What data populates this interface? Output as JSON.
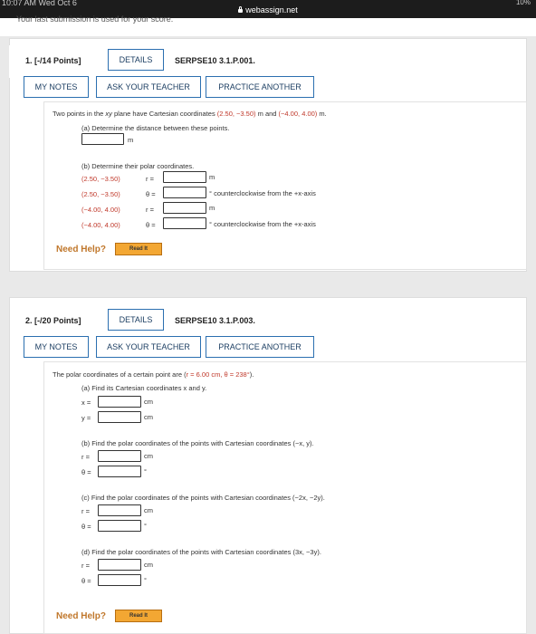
{
  "status_bar": {
    "left_text": "10:07 AM Wed Oct 6",
    "url": "webassign.net",
    "right_text": "10%"
  },
  "page": {
    "submission_text": "Your last submission is used for your score."
  },
  "q1": {
    "number": "1. [-/14 Points]",
    "details": "DETAILS",
    "code": "SERPSE10 3.1.P.001.",
    "my_notes": "MY NOTES",
    "ask_teacher": "ASK YOUR TEACHER",
    "practice": "PRACTICE ANOTHER",
    "intro_a": "Two points in the ",
    "intro_b": "xy",
    "intro_c": " plane have Cartesian coordinates ",
    "intro_d": "(2.50, −3.50)",
    "intro_e": " m and ",
    "intro_f": "(−4.00, 4.00)",
    "intro_g": " m.",
    "part_a": "(a) Determine the distance between these points.",
    "unit_m": "m",
    "part_b": "(b) Determine their polar coordinates.",
    "rows": [
      {
        "coord": "(2.50, −3.50)",
        "var": "r =",
        "unit": "m"
      },
      {
        "coord": "(2.50, −3.50)",
        "var": "θ =",
        "unit": "° counterclockwise from the +x-axis"
      },
      {
        "coord": "(−4.00, 4.00)",
        "var": "r =",
        "unit": "m"
      },
      {
        "coord": "(−4.00, 4.00)",
        "var": "θ =",
        "unit": "° counterclockwise from the +x-axis"
      }
    ],
    "need_help": "Need Help?",
    "read_it": "Read It"
  },
  "q2": {
    "number": "2. [-/20 Points]",
    "details": "DETAILS",
    "code": "SERPSE10 3.1.P.003.",
    "my_notes": "MY NOTES",
    "ask_teacher": "ASK YOUR TEACHER",
    "practice": "PRACTICE ANOTHER",
    "intro_a": "The polar coordinates of a certain point are (",
    "intro_b": "r = 6.00 cm, θ = 238°",
    "intro_c": ").",
    "part_a": "(a) Find its Cartesian coordinates x and y.",
    "a_rows": [
      {
        "var": "x =",
        "unit": "cm"
      },
      {
        "var": "y =",
        "unit": "cm"
      }
    ],
    "part_b": "(b) Find the polar coordinates of the points with Cartesian coordinates (−x, y).",
    "b_rows": [
      {
        "var": "r =",
        "unit": "cm"
      },
      {
        "var": "θ =",
        "unit": "°"
      }
    ],
    "part_c": "(c) Find the polar coordinates of the points with Cartesian coordinates (−2x, −2y).",
    "c_rows": [
      {
        "var": "r =",
        "unit": "cm"
      },
      {
        "var": "θ =",
        "unit": "°"
      }
    ],
    "part_d": "(d) Find the polar coordinates of the points with Cartesian coordinates (3x, −3y).",
    "d_rows": [
      {
        "var": "r =",
        "unit": "cm"
      },
      {
        "var": "θ =",
        "unit": "°"
      }
    ],
    "need_help": "Need Help?",
    "read_it": "Read It"
  }
}
